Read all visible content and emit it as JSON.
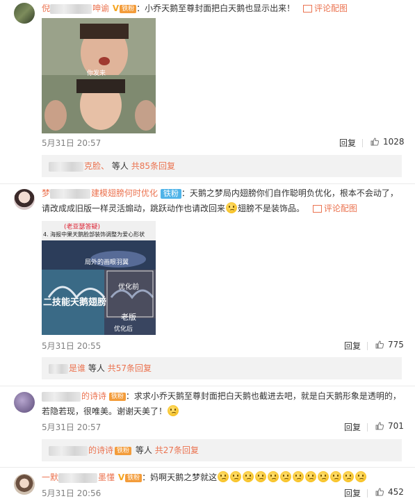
{
  "comments": [
    {
      "user_prefix": "倪",
      "user_suffix": "呻谕",
      "v_mark": "V",
      "fan_badge": "铁粉",
      "text": "：小乔天鹅至尊封面把白天鹅也显示出来！",
      "pic_label": "评论配图",
      "image_caption": "你发来",
      "time": "5月31日 20:57",
      "reply_label": "回复",
      "likes": "1028",
      "replies": {
        "names": "克脸、",
        "middle": "等人",
        "count": "共85条回复"
      }
    },
    {
      "user_prefix": "梦",
      "user_suffix": "建模翅膀何时优化",
      "fan_badge": "铁粉",
      "text_line1": "：天鹅之梦局内翅膀你们自作聪明负优化，根本不会动了，",
      "text_line2a": "请改成成旧版一样灵活煽动，跳跃动作也请改回来",
      "text_line2b": "翅膀不是装饰品。",
      "pic_label": "评论配图",
      "image_banner": "(老亚瑟答疑)",
      "image_heading": "4. 海报中果天鹅脸部装饰调整为爱心形状",
      "image_tag1": "局外的画眼羽翼",
      "image_tag2": "二技能天鹅翅膀",
      "image_tag3": "优化前",
      "image_tag4": "老版",
      "image_tag5": "优化后",
      "time": "5月31日 20:55",
      "reply_label": "回复",
      "likes": "775",
      "replies": {
        "names": "是谁",
        "middle": "等人",
        "count": "共57条回复"
      }
    },
    {
      "user_suffix": "的诗诗",
      "fan_badge": "铁粉",
      "text_line1": "：求求小乔天鹅至尊封面把白天鹅也截进去吧，就是白天鹅形象是透明的，",
      "text_line2": "若隐若现，很唯美。谢谢天美了！",
      "time": "5月31日 20:57",
      "reply_label": "回复",
      "likes": "701",
      "replies": {
        "names": "的诗诗",
        "middle": "等人",
        "count": "共27条回复"
      }
    },
    {
      "user_prefix": "一默",
      "user_suffix": "墨懂",
      "v_mark": "V",
      "fan_badge": "铁粉",
      "text": "：妈啊天鹅之梦就这",
      "time": "5月31日 20:56",
      "reply_label": "回复",
      "likes": "452"
    }
  ]
}
